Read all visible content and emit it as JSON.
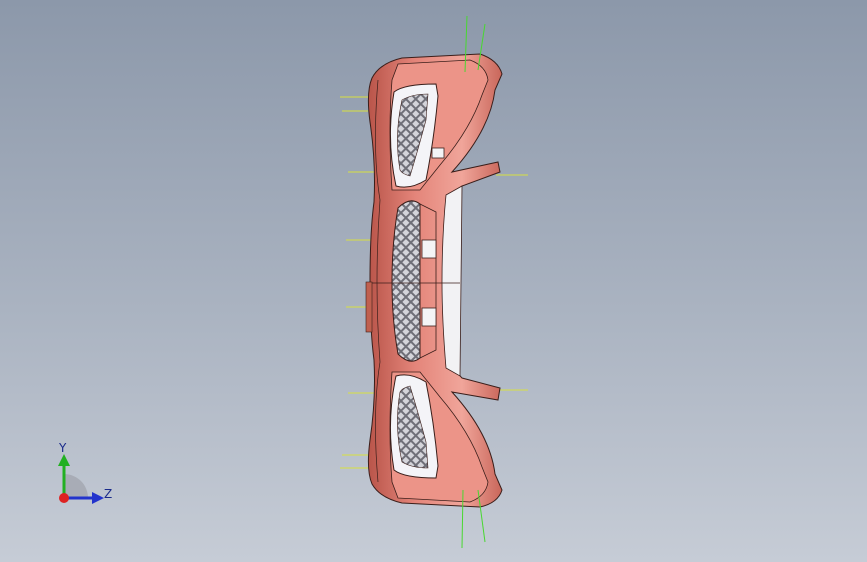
{
  "viewport": {
    "background_top": "#8c98aa",
    "background_bottom": "#c6ccd6"
  },
  "model": {
    "name_icon": "front-bumper-model",
    "body_color": "#d9766a",
    "edge_color": "#3a1e1a",
    "grille_color": "#7a7a80",
    "chrome_color": "#e8e8ee",
    "reference_line_color": "#d8e040",
    "normal_line_color": "#48d830"
  },
  "triad": {
    "icon": "coordinate-triad-icon",
    "y_label": "Y",
    "z_label": "Z",
    "y_color": "#22b022",
    "z_color": "#2233cc",
    "x_color": "#dd2222"
  }
}
